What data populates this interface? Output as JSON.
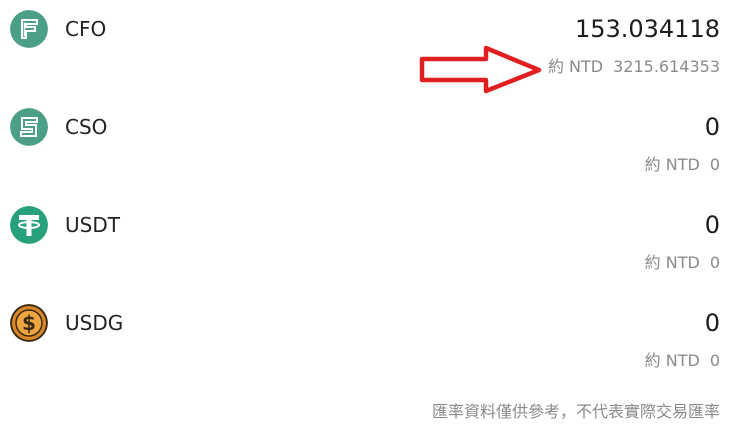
{
  "assets": [
    {
      "symbol": "CFO",
      "icon": "cfo-coin-icon",
      "icon_color": "#4a9f86",
      "amount": "153.034118",
      "approx_label": "約 NTD",
      "fiat_value": "3215.614353"
    },
    {
      "symbol": "CSO",
      "icon": "cso-coin-icon",
      "icon_color": "#4a9f86",
      "amount": "0",
      "approx_label": "約 NTD",
      "fiat_value": "0"
    },
    {
      "symbol": "USDT",
      "icon": "tether-icon",
      "icon_color": "#26a17b",
      "amount": "0",
      "approx_label": "約 NTD",
      "fiat_value": "0"
    },
    {
      "symbol": "USDG",
      "icon": "dollar-coin-icon",
      "icon_color": "#d9872a",
      "amount": "0",
      "approx_label": "約 NTD",
      "fiat_value": "0"
    }
  ],
  "annotation": {
    "type": "red-arrow",
    "color": "#e02020",
    "points_to": "CFO fiat value"
  },
  "disclaimer": "匯率資料僅供參考，不代表實際交易匯率"
}
